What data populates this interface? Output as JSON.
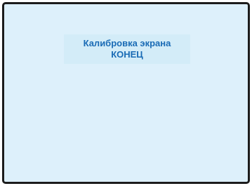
{
  "screen": {
    "title_line1": "Калибровка экрана",
    "title_line2": "КОНЕЦ"
  },
  "colors": {
    "background": "#ddf0fb",
    "text": "#1a6bb5",
    "border": "#1c1c1c"
  }
}
